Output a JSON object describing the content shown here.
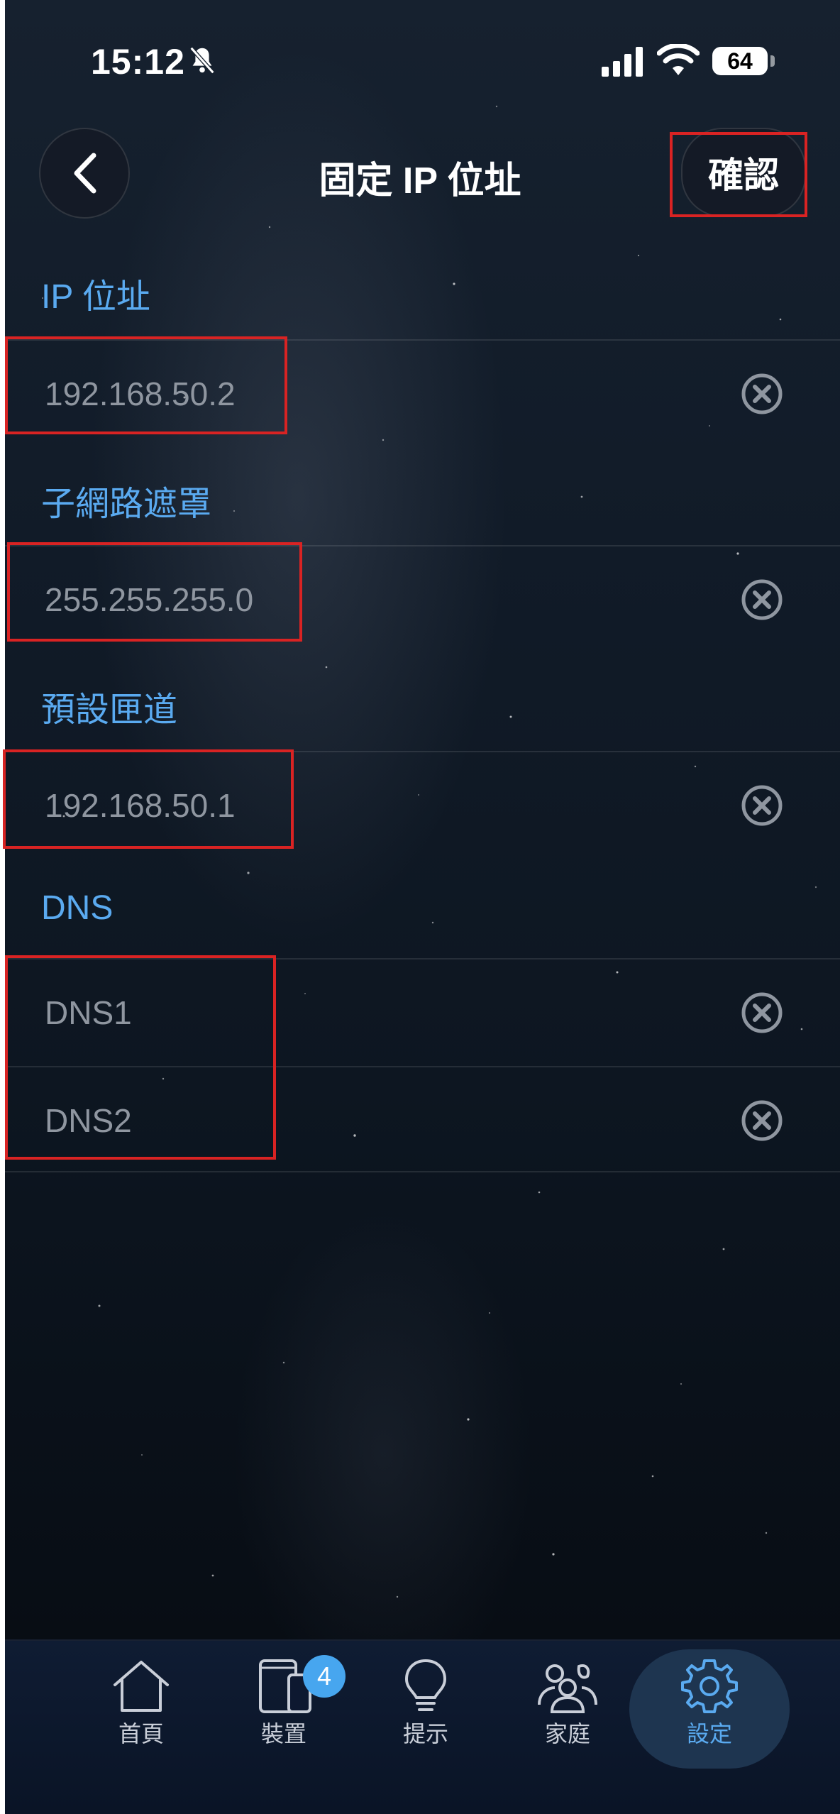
{
  "status_bar": {
    "time": "15:12",
    "battery": "64"
  },
  "nav": {
    "title": "固定 IP 位址",
    "confirm_label": "確認"
  },
  "form": {
    "ip": {
      "label": "IP 位址",
      "value": "",
      "placeholder": "192.168.50.2"
    },
    "subnet": {
      "label": "子網路遮罩",
      "value": "",
      "placeholder": "255.255.255.0"
    },
    "gateway": {
      "label": "預設匣道",
      "value": "",
      "placeholder": "192.168.50.1"
    },
    "dns": {
      "label": "DNS",
      "dns1": {
        "value": "",
        "placeholder": "DNS1"
      },
      "dns2": {
        "value": "",
        "placeholder": "DNS2"
      }
    }
  },
  "tabbar": {
    "items": [
      {
        "label": "首頁",
        "icon": "home-icon"
      },
      {
        "label": "裝置",
        "icon": "devices-icon",
        "badge": "4"
      },
      {
        "label": "提示",
        "icon": "lightbulb-icon"
      },
      {
        "label": "家庭",
        "icon": "family-icon"
      },
      {
        "label": "設定",
        "icon": "gear-icon",
        "active": true
      }
    ]
  },
  "colors": {
    "accent": "#5aaaf0",
    "highlight": "#d92323",
    "active_tab": "#5aaaf0",
    "badge": "#47a6ef"
  }
}
